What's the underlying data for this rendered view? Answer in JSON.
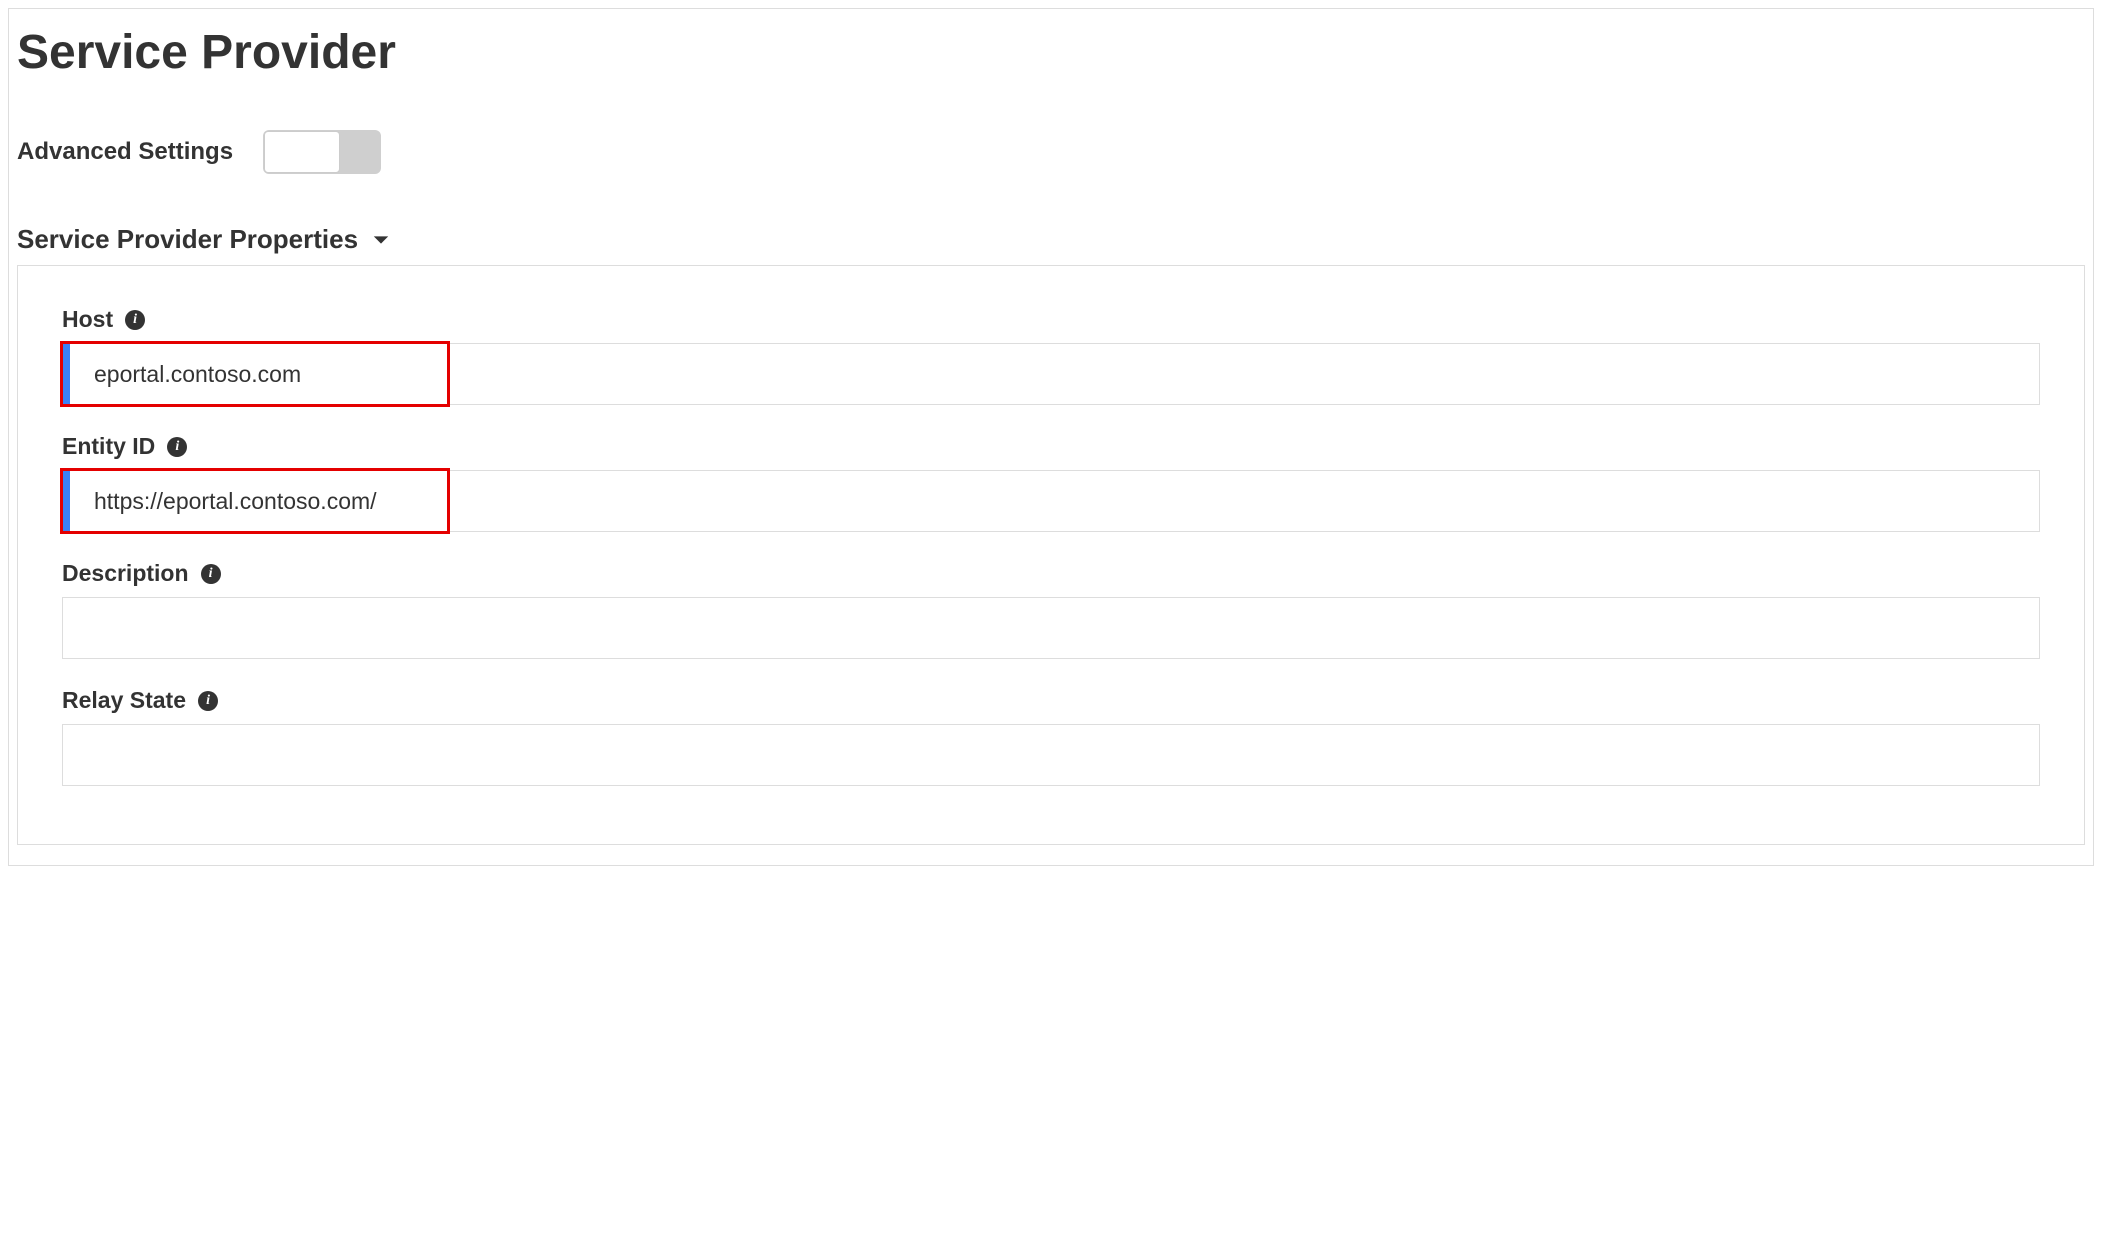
{
  "title": "Service Provider",
  "advanced_label": "Advanced Settings",
  "section_title": "Service Provider Properties",
  "fields": {
    "host": {
      "label": "Host",
      "value": "eportal.contoso.com"
    },
    "entity_id": {
      "label": "Entity ID",
      "value": "https://eportal.contoso.com/"
    },
    "description": {
      "label": "Description",
      "value": ""
    },
    "relay_state": {
      "label": "Relay State",
      "value": ""
    }
  }
}
